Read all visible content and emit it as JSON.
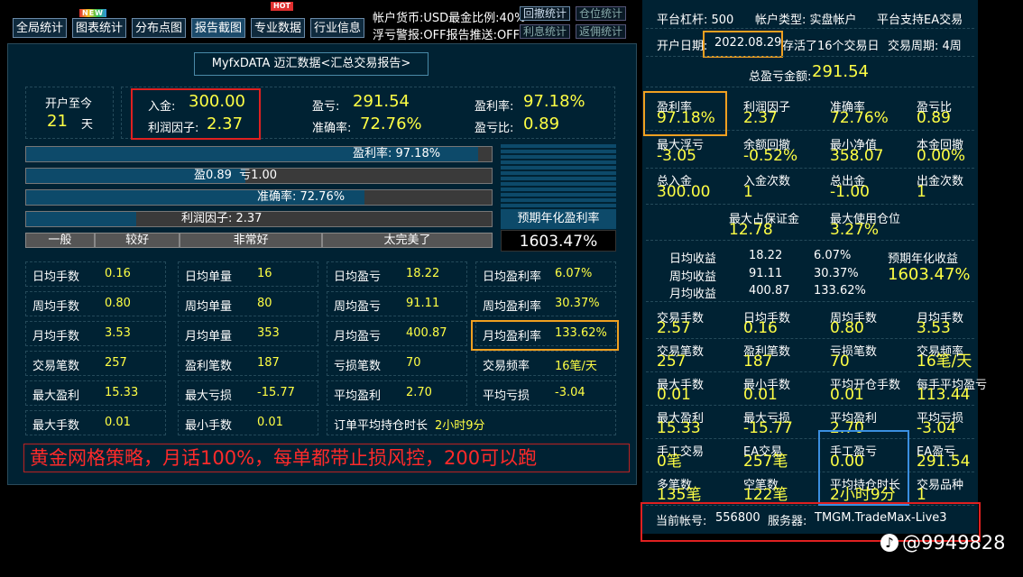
{
  "toolbar": {
    "buttons": [
      "全局统计",
      "图表统计",
      "分布点图",
      "报告截图",
      "专业数据",
      "行业信息"
    ],
    "new_badge": "NEW",
    "hot_badge": "HOT",
    "account_currency": "帐户货币:USD最金比例:40%",
    "float_alert": "浮亏警报:OFF报告推送:OFF",
    "small_buttons": [
      "回撤统计",
      "仓位统计",
      "利息统计",
      "返佣统计"
    ]
  },
  "report_title": "MyfxDATA 迈汇数据<汇总交易报告>",
  "summary": {
    "open_label": "开户至今",
    "open_days": "21",
    "days_unit": "天",
    "deposit_label": "入金:",
    "deposit_value": "300.00",
    "profit_factor_label": "利润因子:",
    "profit_factor_value": "2.37",
    "pnl_label": "盈亏:",
    "pnl_value": "291.54",
    "profit_rate_label": "盈利率:",
    "profit_rate_value": "97.18%",
    "accuracy_label": "准确率:",
    "accuracy_value": "72.76%",
    "pl_ratio_label": "盈亏比:",
    "pl_ratio_value": "0.89"
  },
  "bars": {
    "profit_rate": {
      "label": "盈利率: 97.18%",
      "fraction": 0.9718
    },
    "pl_win": "盈0.89",
    "pl_loss": "亏1.00",
    "pl_win_fraction": 0.47,
    "accuracy": {
      "label": "准确率: 72.76%",
      "fraction": 0.7276
    },
    "profit_factor": {
      "label": "利润因子: 2.37",
      "fraction": 0.237
    },
    "scale": [
      "一般",
      "较好",
      "非常好",
      "太完美了"
    ],
    "annual_label": "预期年化盈利率",
    "annual_value": "1603.47%"
  },
  "grid": [
    [
      [
        "日均手数",
        "0.16"
      ],
      [
        "日均单量",
        "16"
      ],
      [
        "日均盈亏",
        "18.22"
      ],
      [
        "日均盈利率",
        "6.07%"
      ]
    ],
    [
      [
        "周均手数",
        "0.80"
      ],
      [
        "周均单量",
        "80"
      ],
      [
        "周均盈亏",
        "91.11"
      ],
      [
        "周均盈利率",
        "30.37%"
      ]
    ],
    [
      [
        "月均手数",
        "3.53"
      ],
      [
        "月均单量",
        "353"
      ],
      [
        "月均盈亏",
        "400.87"
      ],
      [
        "月均盈利率",
        "133.62%"
      ]
    ],
    [
      [
        "交易笔数",
        "257"
      ],
      [
        "盈利笔数",
        "187"
      ],
      [
        "亏损笔数",
        "70"
      ],
      [
        "交易频率",
        "16笔/天"
      ]
    ],
    [
      [
        "最大盈利",
        "15.33"
      ],
      [
        "最大亏损",
        "-15.77"
      ],
      [
        "平均盈利",
        "2.70"
      ],
      [
        "平均亏损",
        "-3.04"
      ]
    ],
    [
      [
        "最大手数",
        "0.01"
      ],
      [
        "最小手数",
        "0.01"
      ],
      [
        "订单平均持仓时长",
        "2小时9分"
      ]
    ]
  ],
  "strategy_text": "黄金网格策略，月话100%，每单都带止损风控，200可以跑",
  "right": {
    "leverage": "平台杠杆: 500",
    "account_type": "帐户类型: 实盘帐户",
    "ea_support": "平台支持EA交易",
    "open_date_label": "开户日期:",
    "open_date": "2022.08.29",
    "survived": "存活了16个交易日",
    "period": "交易周期: 4周",
    "total_pnl_label": "总盈亏金额:",
    "total_pnl": "291.54",
    "rows": [
      [
        [
          "盈利率",
          "97.18%"
        ],
        [
          "利润因子",
          "2.37"
        ],
        [
          "准确率",
          "72.76%"
        ],
        [
          "盈亏比",
          "0.89"
        ]
      ],
      [
        [
          "最大浮亏",
          "-3.05"
        ],
        [
          "余额回撤",
          "-0.52%"
        ],
        [
          "最小净值",
          "358.07"
        ],
        [
          "本金回撤",
          "0.00%"
        ]
      ],
      [
        [
          "总入金",
          "300.00"
        ],
        [
          "入金次数",
          "1"
        ],
        [
          "总出金",
          "-1.00"
        ],
        [
          "出金次数",
          "1"
        ]
      ]
    ],
    "margin_label": "最大占保证金",
    "margin_value": "12.78",
    "max_pos_label": "最大使用仓位",
    "max_pos_value": "3.27%",
    "avg_rows": [
      [
        "日均收益",
        "18.22",
        "6.07%"
      ],
      [
        "周均收益",
        "91.11",
        "30.37%"
      ],
      [
        "月均收益",
        "400.87",
        "133.62%"
      ]
    ],
    "annual_label": "预期年化收益",
    "annual_value": "1603.47%",
    "rows2": [
      [
        [
          "交易手数",
          "2.57"
        ],
        [
          "日均手数",
          "0.16"
        ],
        [
          "周均手数",
          "0.80"
        ],
        [
          "月均手数",
          "3.53"
        ]
      ],
      [
        [
          "交易笔数",
          "257"
        ],
        [
          "盈利笔数",
          "187"
        ],
        [
          "亏损笔数",
          "70"
        ],
        [
          "交易频率",
          "16笔/天"
        ]
      ],
      [
        [
          "最大手数",
          "0.01"
        ],
        [
          "最小手数",
          "0.01"
        ],
        [
          "平均开仓手数",
          "0.01"
        ],
        [
          "每手平均盈亏",
          "113.44"
        ]
      ],
      [
        [
          "最大盈利",
          "15.33"
        ],
        [
          "最大亏损",
          "-15.77"
        ],
        [
          "平均盈利",
          "2.70"
        ],
        [
          "平均亏损",
          "-3.04"
        ]
      ],
      [
        [
          "手工交易",
          "0笔"
        ],
        [
          "EA交易",
          "257笔"
        ],
        [
          "手工盈亏",
          "0.00"
        ],
        [
          "EA盈亏",
          "291.54"
        ]
      ],
      [
        [
          "多笔数",
          "135笔"
        ],
        [
          "空笔数",
          "122笔"
        ],
        [
          "平均持仓时长",
          "2小时9分"
        ],
        [
          "交易品种",
          "1"
        ]
      ]
    ],
    "account_label": "当前帐号:",
    "account_no": "556800",
    "server_label": "服务器:",
    "server": "TMGM.TradeMax-Live3"
  },
  "watermark": "@9949828",
  "colors": {
    "highlight_orange": "#f0a020",
    "highlight_red": "#e02020",
    "highlight_blue": "#3a8fe0",
    "value_yellow": "#ffff44"
  }
}
